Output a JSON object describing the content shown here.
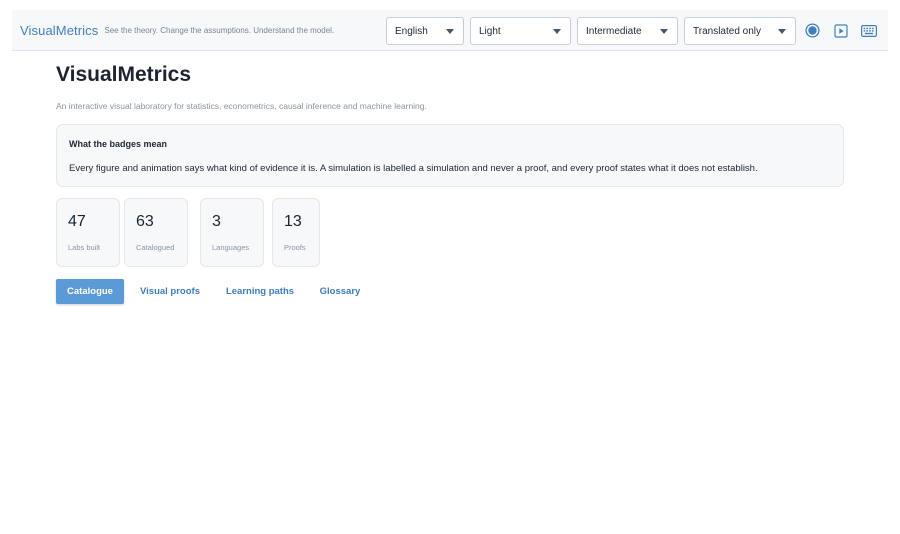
{
  "header": {
    "brand": "VisualMetrics",
    "tagline": "See the theory. Change the assumptions. Understand the model.",
    "selects": {
      "language": "English",
      "theme": "Light",
      "level": "Intermediate",
      "translation": "Translated only"
    },
    "icons": [
      "record-icon",
      "play-icon",
      "keyboard-icon"
    ]
  },
  "main": {
    "title": "VisualMetrics",
    "subtitle": "An interactive visual laboratory for statistics, econometrics, causal inference and machine learning.",
    "badges_card": {
      "heading": "What the badges mean",
      "text": "Every figure and animation says what kind of evidence it is. A simulation is labelled a simulation and never a proof, and every proof states what it does not establish."
    },
    "stats": [
      {
        "value": "47",
        "label": "Labs built"
      },
      {
        "value": "63",
        "label": "Catalogued"
      },
      {
        "value": "3",
        "label": "Languages"
      },
      {
        "value": "13",
        "label": "Proofs"
      }
    ],
    "tabs": [
      {
        "label": "Catalogue",
        "active": true
      },
      {
        "label": "Visual proofs",
        "active": false
      },
      {
        "label": "Learning paths",
        "active": false
      },
      {
        "label": "Glossary",
        "active": false
      }
    ]
  },
  "colors": {
    "accent": "#3f7fc0",
    "active_tab": "#5a9ad6",
    "panel_bg": "#f6f8fa"
  }
}
